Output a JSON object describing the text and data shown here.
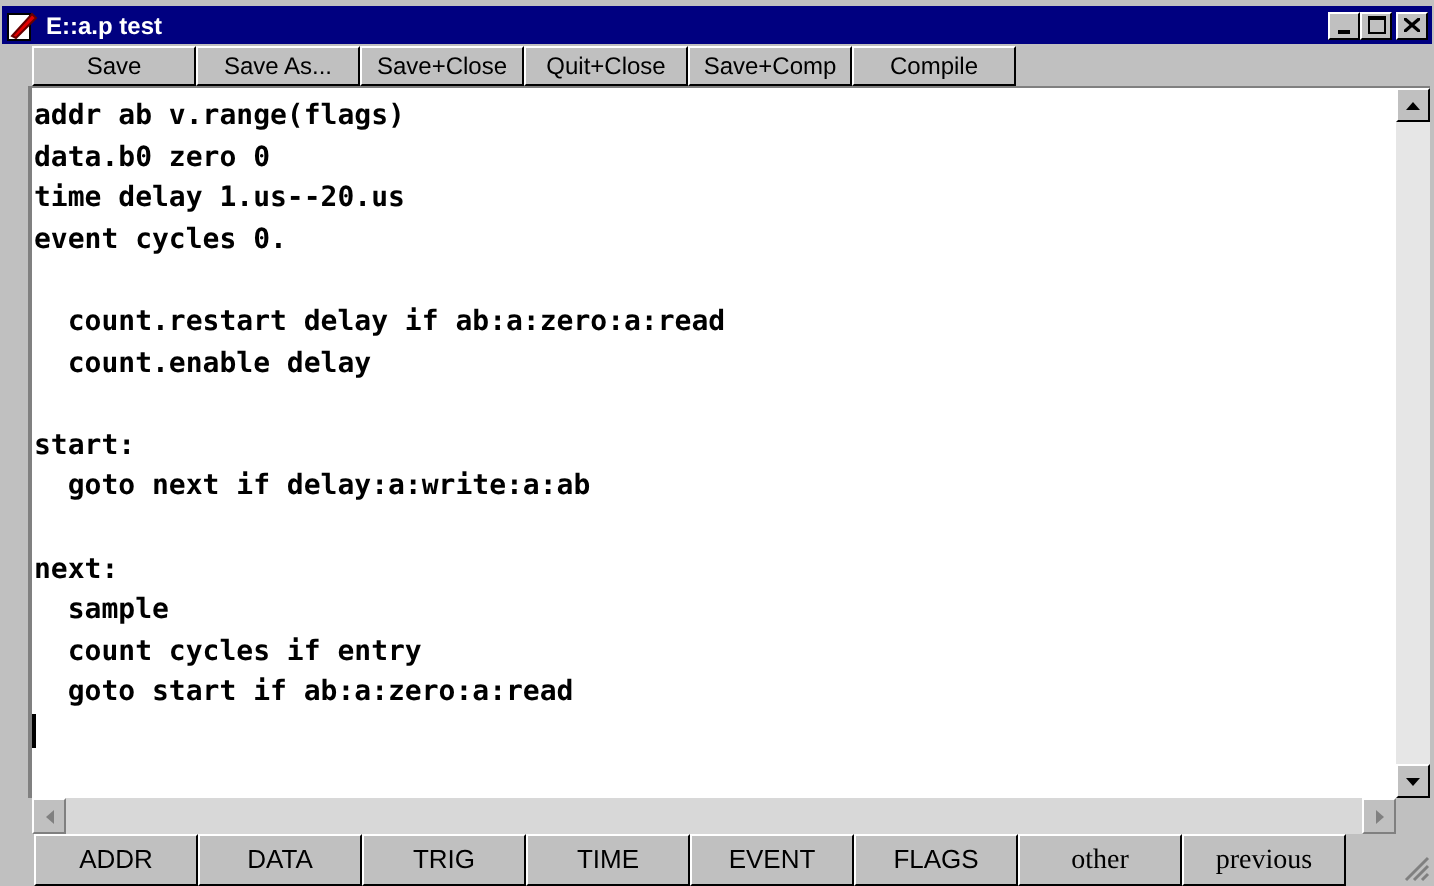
{
  "window": {
    "title": "E::a.p test"
  },
  "toolbar": [
    "Save",
    "Save As...",
    "Save+Close",
    "Quit+Close",
    "Save+Comp",
    "Compile"
  ],
  "editor": {
    "blocks": [
      [
        "addr ab v.range(flags)",
        "data.b0 zero 0",
        "time delay 1.us--20.us",
        "event cycles 0."
      ],
      [
        "  count.restart delay if ab:a:zero:a:read",
        "  count.enable delay"
      ],
      [
        "start:",
        "  goto next if delay:a:write:a:ab"
      ],
      [
        "next:",
        "  sample",
        "  count cycles if entry",
        "  goto start if ab:a:zero:a:read"
      ]
    ]
  },
  "bottom_buttons": [
    {
      "label": "ADDR",
      "kind": "sans"
    },
    {
      "label": "DATA",
      "kind": "sans"
    },
    {
      "label": "TRIG",
      "kind": "sans"
    },
    {
      "label": "TIME",
      "kind": "sans"
    },
    {
      "label": "EVENT",
      "kind": "sans"
    },
    {
      "label": "FLAGS",
      "kind": "sans"
    },
    {
      "label": "other",
      "kind": "serif"
    },
    {
      "label": "previous",
      "kind": "serif"
    }
  ]
}
